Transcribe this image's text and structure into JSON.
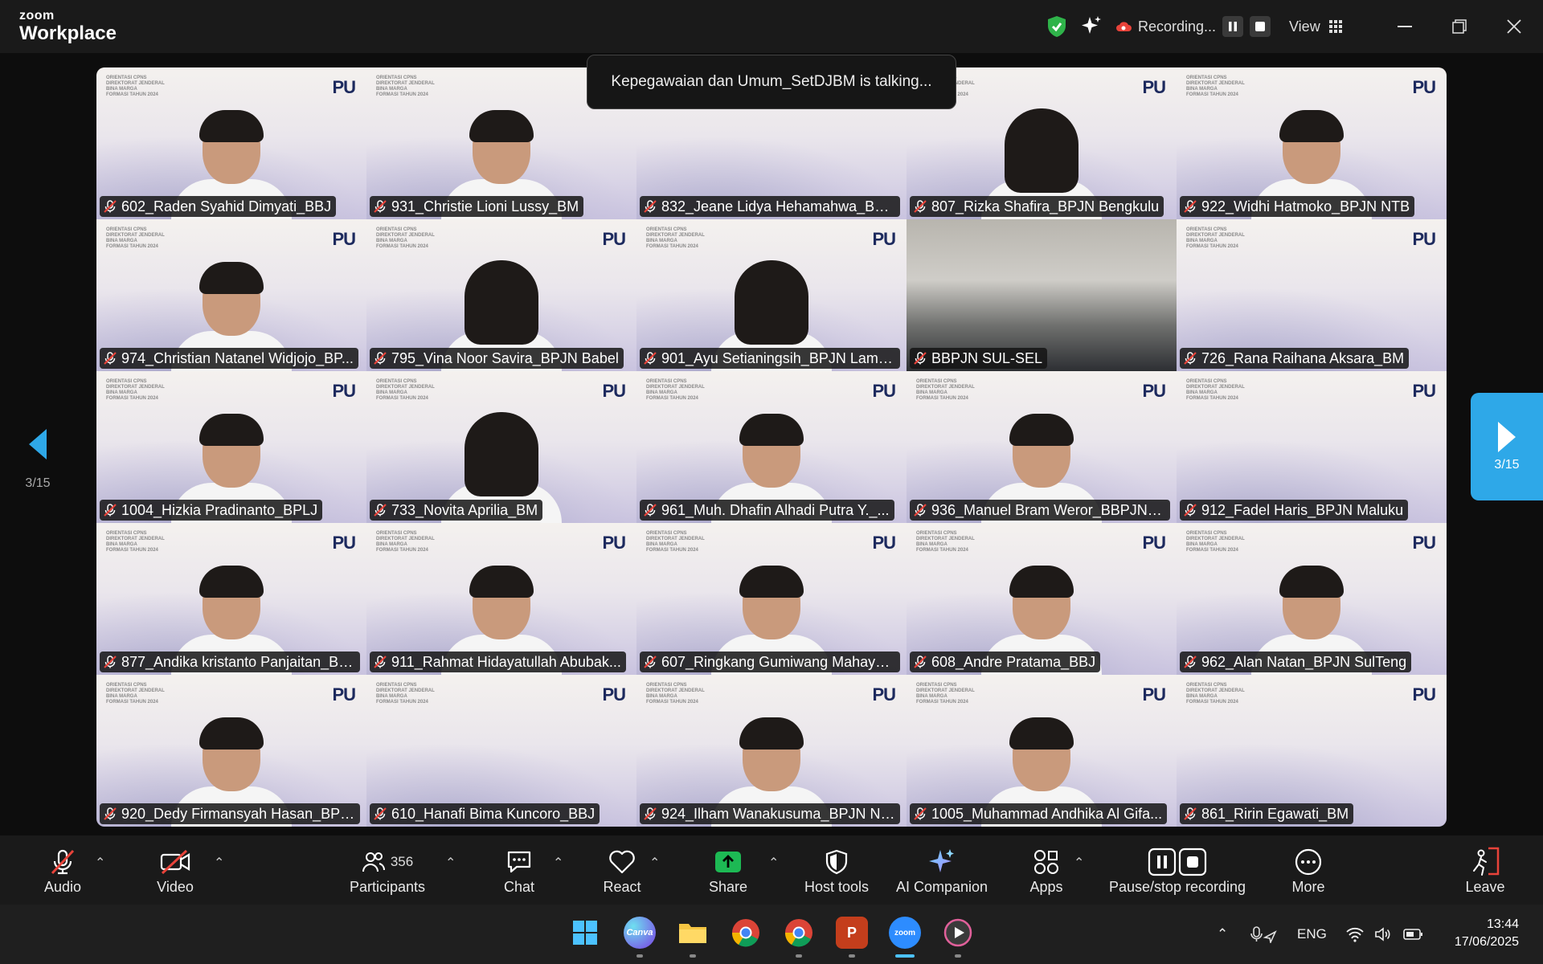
{
  "app": {
    "logo_top": "zoom",
    "logo_bottom": "Workplace"
  },
  "titlebar": {
    "recording_label": "Recording...",
    "view_label": "View"
  },
  "toast": "Kepegawaian dan Umum_SetDJBM is talking...",
  "pager": {
    "left_count": "3/15",
    "right_count": "3/15"
  },
  "tile_header": {
    "line1": "ORIENTASI CPNS",
    "line2": "DIREKTORAT JENDERAL",
    "line3": "BINA MARGA",
    "line4": "FORMASI TAHUN 2024",
    "logo": "PU"
  },
  "participants": [
    {
      "name": "602_Raden Syahid Dimyati_BBJ"
    },
    {
      "name": "931_Christie Lioni Lussy_BM"
    },
    {
      "name": "832_Jeane Lidya Hehamahwa_BBP..."
    },
    {
      "name": "807_Rizka Shafira_BPJN Bengkulu"
    },
    {
      "name": "922_Widhi Hatmoko_BPJN NTB"
    },
    {
      "name": "974_Christian Natanel Widjojo_BP..."
    },
    {
      "name": "795_Vina Noor Savira_BPJN Babel"
    },
    {
      "name": "901_Ayu Setianingsih_BPJN Lamp..."
    },
    {
      "name": "BBPJN SUL-SEL"
    },
    {
      "name": "726_Rana Raihana Aksara_BM"
    },
    {
      "name": "1004_Hizkia Pradinanto_BPLJ"
    },
    {
      "name": "733_Novita Aprilia_BM"
    },
    {
      "name": "961_Muh. Dhafin Alhadi Putra Y._..."
    },
    {
      "name": "936_Manuel Bram Weror_BBPJN P..."
    },
    {
      "name": "912_Fadel Haris_BPJN Maluku"
    },
    {
      "name": "877_Andika kristanto Panjaitan_BP..."
    },
    {
      "name": "911_Rahmat Hidayatullah Abubak..."
    },
    {
      "name": "607_Ringkang Gumiwang Mahaya..."
    },
    {
      "name": "608_Andre Pratama_BBJ"
    },
    {
      "name": "962_Alan Natan_BPJN SulTeng"
    },
    {
      "name": "920_Dedy Firmansyah Hasan_BPJ..."
    },
    {
      "name": "610_Hanafi Bima Kuncoro_BBJ"
    },
    {
      "name": "924_Ilham Wanakusuma_BPJN NTB"
    },
    {
      "name": "1005_Muhammad Andhika Al Gifa..."
    },
    {
      "name": "861_Ririn Egawati_BM"
    }
  ],
  "toolbar": {
    "audio": "Audio",
    "video": "Video",
    "participants": "Participants",
    "participant_count": "356",
    "chat": "Chat",
    "react": "React",
    "share": "Share",
    "host_tools": "Host tools",
    "ai_companion": "AI Companion",
    "apps": "Apps",
    "pause_stop": "Pause/stop recording",
    "more": "More",
    "leave": "Leave"
  },
  "taskbar": {
    "canva": "Canva",
    "zoom": "zoom",
    "powerpoint": "P",
    "language": "ENG",
    "time": "13:44",
    "date": "17/06/2025"
  },
  "colors": {
    "share_green": "#1db954",
    "leave_red": "#e8433a",
    "pager_blue": "#2ea8e8",
    "shield_green": "#2fb34a"
  }
}
